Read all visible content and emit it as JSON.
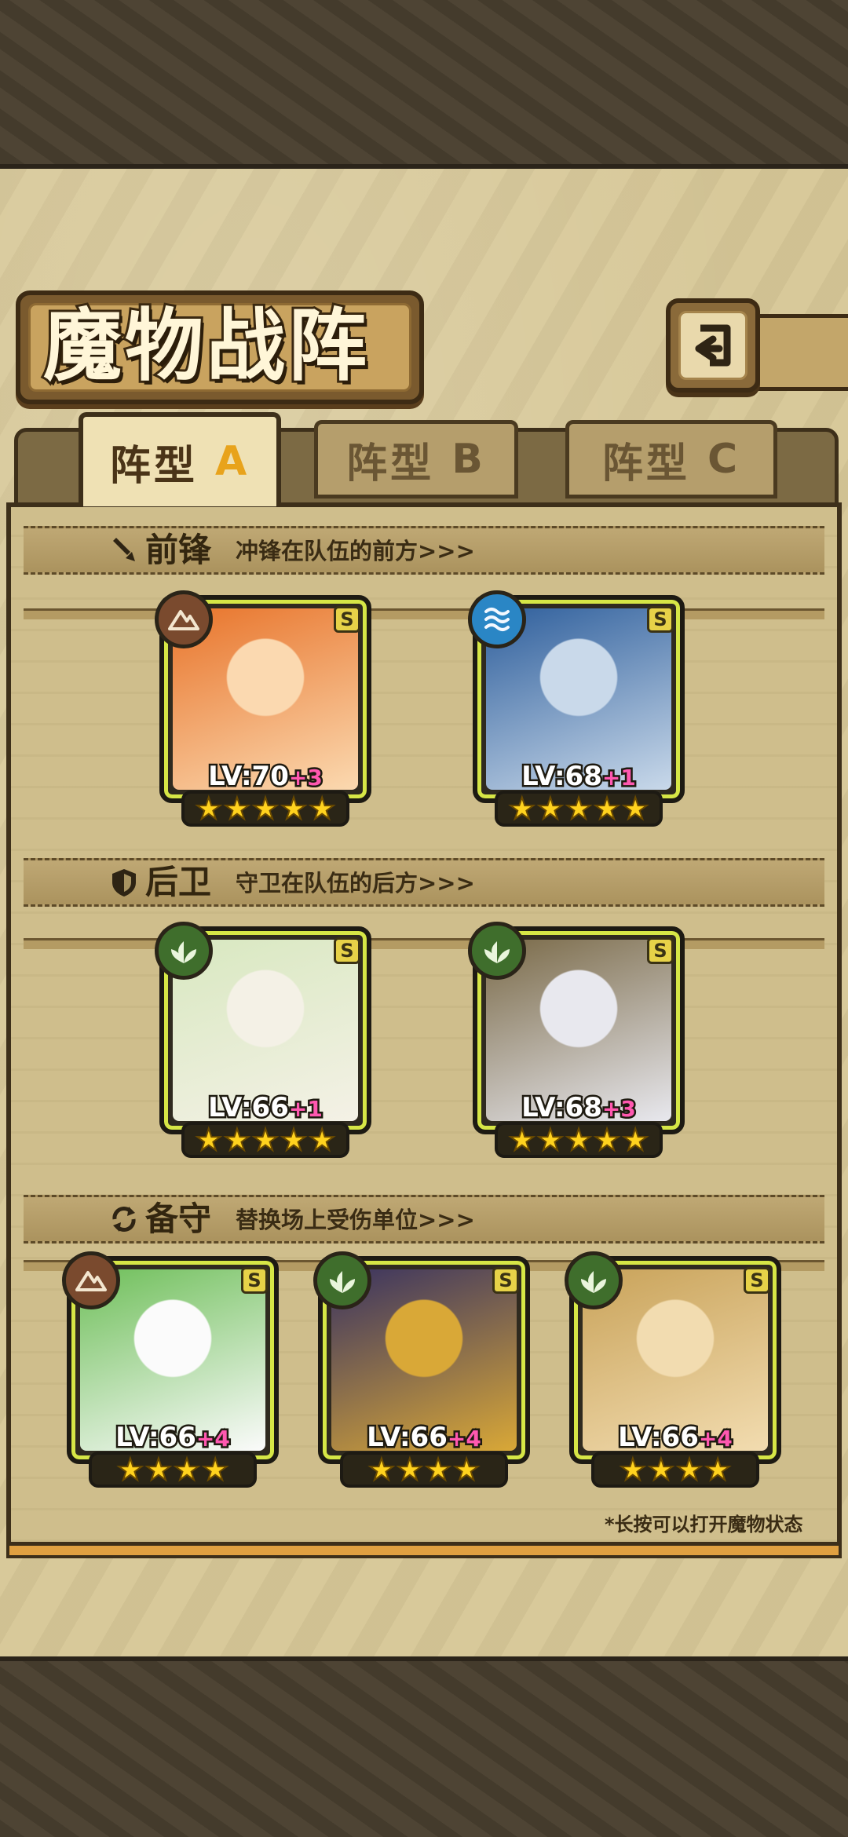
{
  "header": {
    "title": "魔物战阵"
  },
  "tabs": [
    {
      "prefix": "阵型",
      "letter": "A",
      "active": true
    },
    {
      "prefix": "阵型",
      "letter": "B",
      "active": false
    },
    {
      "prefix": "阵型",
      "letter": "C",
      "active": false
    }
  ],
  "sections": {
    "front": {
      "title": "前锋",
      "desc": "冲锋在队伍的前方>>>",
      "icon": "sword-icon"
    },
    "back": {
      "title": "后卫",
      "desc": "守卫在队伍的后方>>>",
      "icon": "shield-icon"
    },
    "reserve": {
      "title": "备守",
      "desc": "替换场上受伤单位>>>",
      "icon": "swap-icon"
    }
  },
  "cards": [
    {
      "id": "front-1",
      "rank": "S",
      "element": "earth",
      "level": "LV:70",
      "plus": "+3",
      "stars": 5,
      "palette": [
        "#e8742b",
        "#fbd9b0"
      ]
    },
    {
      "id": "front-2",
      "rank": "S",
      "element": "water",
      "level": "LV:68",
      "plus": "+1",
      "stars": 5,
      "palette": [
        "#2f5f9c",
        "#c9d9ea"
      ]
    },
    {
      "id": "back-1",
      "rank": "S",
      "element": "grass",
      "level": "LV:66",
      "plus": "+1",
      "stars": 5,
      "palette": [
        "#d8e8c0",
        "#f4f1e6"
      ]
    },
    {
      "id": "back-2",
      "rank": "S",
      "element": "grass",
      "level": "LV:68",
      "plus": "+3",
      "stars": 5,
      "palette": [
        "#7a6a48",
        "#e8e8ee"
      ]
    },
    {
      "id": "reserve-1",
      "rank": "S",
      "element": "earth",
      "level": "LV:66",
      "plus": "+4",
      "stars": 4,
      "palette": [
        "#6fbf5a",
        "#fbfbfb"
      ]
    },
    {
      "id": "reserve-2",
      "rank": "S",
      "element": "grass",
      "level": "LV:66",
      "plus": "+4",
      "stars": 4,
      "palette": [
        "#3a3360",
        "#d9a837"
      ]
    },
    {
      "id": "reserve-3",
      "rank": "S",
      "element": "grass",
      "level": "LV:66",
      "plus": "+4",
      "stars": 4,
      "palette": [
        "#c9a35a",
        "#f2dcb0"
      ]
    }
  ],
  "footer": {
    "hint": "*长按可以打开魔物状态"
  },
  "colors": {
    "frame": "#d6e646",
    "star": "#ffd21e",
    "plus": "#ff58b0",
    "earth": "#7a4a2e",
    "water": "#2a86c5",
    "grass": "#3f6e2c"
  }
}
